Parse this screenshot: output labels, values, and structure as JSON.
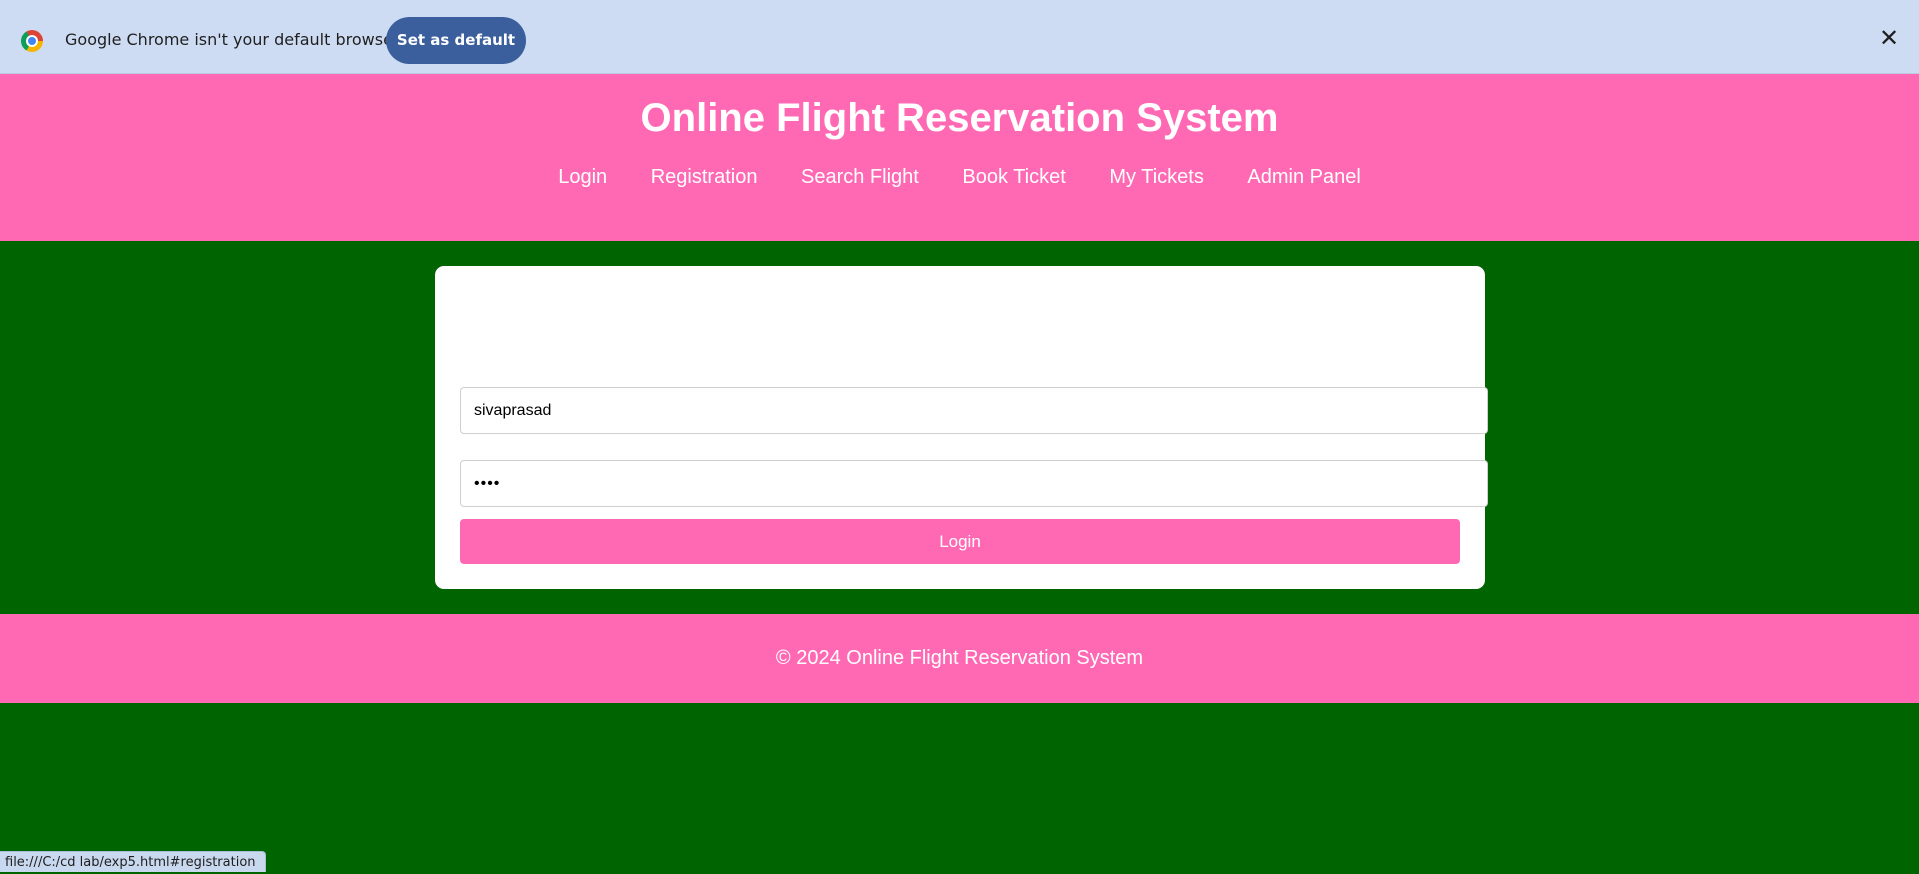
{
  "infobar": {
    "message": "Google Chrome isn't your default browser",
    "set_default_label": "Set as default",
    "close_glyph": "✕"
  },
  "header": {
    "title": "Online Flight Reservation System",
    "nav": [
      "Login",
      "Registration",
      "Search Flight",
      "Book Ticket",
      "My Tickets",
      "Admin Panel"
    ]
  },
  "login_form": {
    "username_value": "sivaprasad",
    "password_value": "••••",
    "submit_label": "Login"
  },
  "footer": {
    "text": "© 2024 Online Flight Reservation System"
  },
  "status_bar": {
    "url": "file:///C:/cd lab/exp5.html#registration"
  },
  "colors": {
    "header_bg": "#ff69b4",
    "page_bg": "#006400",
    "infobar_bg": "#cddcf3",
    "primary_button": "#3a5f9c"
  }
}
